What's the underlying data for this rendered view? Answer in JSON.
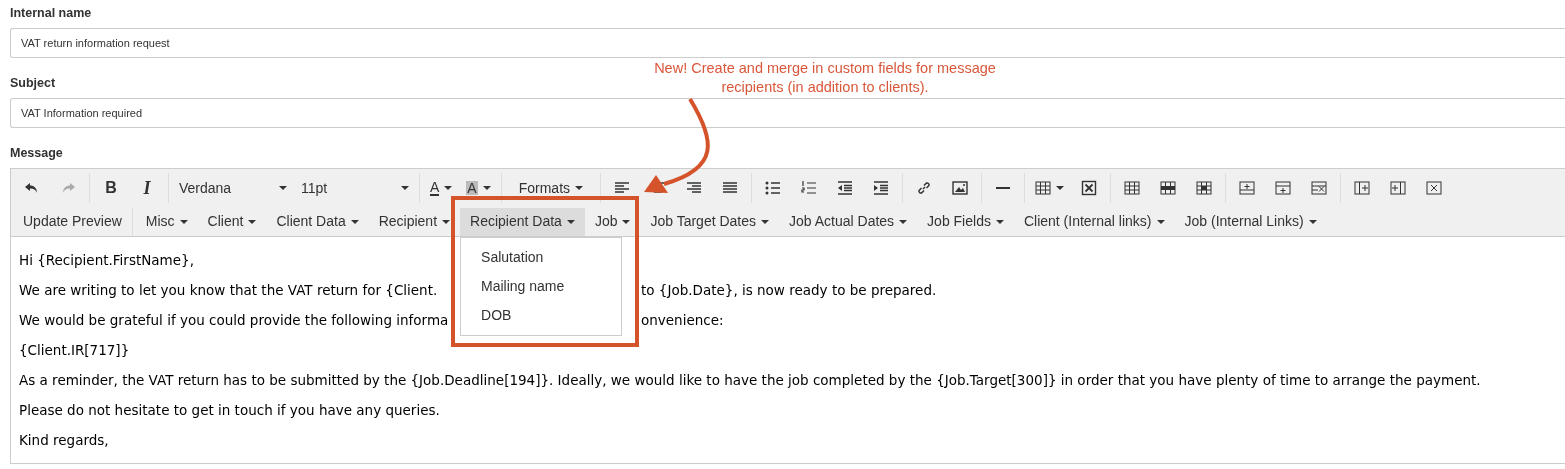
{
  "fields": [
    {
      "label": "Internal name",
      "value": "VAT return information request"
    },
    {
      "label": "Subject",
      "value": "VAT Information required"
    }
  ],
  "message": {
    "label": "Message",
    "toolbar": {
      "bold": "B",
      "italic": "I",
      "font": "Verdana",
      "size": "11pt",
      "text_color": "A",
      "bg_color": "A",
      "formats": "Formats"
    },
    "menus": [
      {
        "label": "Update Preview",
        "kind": "button",
        "selected": false
      },
      {
        "label": "Misc",
        "kind": "menu",
        "selected": false
      },
      {
        "label": "Client",
        "kind": "menu",
        "selected": false
      },
      {
        "label": "Client Data",
        "kind": "menu",
        "selected": false
      },
      {
        "label": "Recipient",
        "kind": "menu",
        "selected": false
      },
      {
        "label": "Recipient Data",
        "kind": "menu",
        "selected": true
      },
      {
        "label": "Job",
        "kind": "menu",
        "selected": false
      },
      {
        "label": "Job Target Dates",
        "kind": "menu",
        "selected": false
      },
      {
        "label": "Job Actual Dates",
        "kind": "menu",
        "selected": false
      },
      {
        "label": "Job Fields",
        "kind": "menu",
        "selected": false
      },
      {
        "label": "Client (Internal links)",
        "kind": "menu",
        "selected": false
      },
      {
        "label": "Job (Internal Links)",
        "kind": "menu",
        "selected": false
      }
    ],
    "dropdown": [
      "Salutation",
      "Mailing name",
      "DOB"
    ],
    "body": [
      [
        "Hi {Recipient.FirstName},"
      ],
      [
        "We are writing to let you know that the VAT return for {Client.",
        "to {Job.Date}, is now ready to be prepared."
      ],
      [
        "We would be grateful if you could provide the following informa",
        "onvenience:"
      ],
      [
        "{Client.IR[717]}"
      ],
      [
        "As a reminder, the VAT return has to be submitted by the {Job.Deadline[194]}. Ideally, we would like to have the job completed by the {Job.Target[300]} in order that you have plenty of time to arrange the payment."
      ],
      [
        "Please do not hesitate to get in touch if you have any queries."
      ],
      [
        "Kind regards,"
      ]
    ]
  },
  "annotation": "New! Create and merge in custom fields for message recipients (in addition to clients)."
}
